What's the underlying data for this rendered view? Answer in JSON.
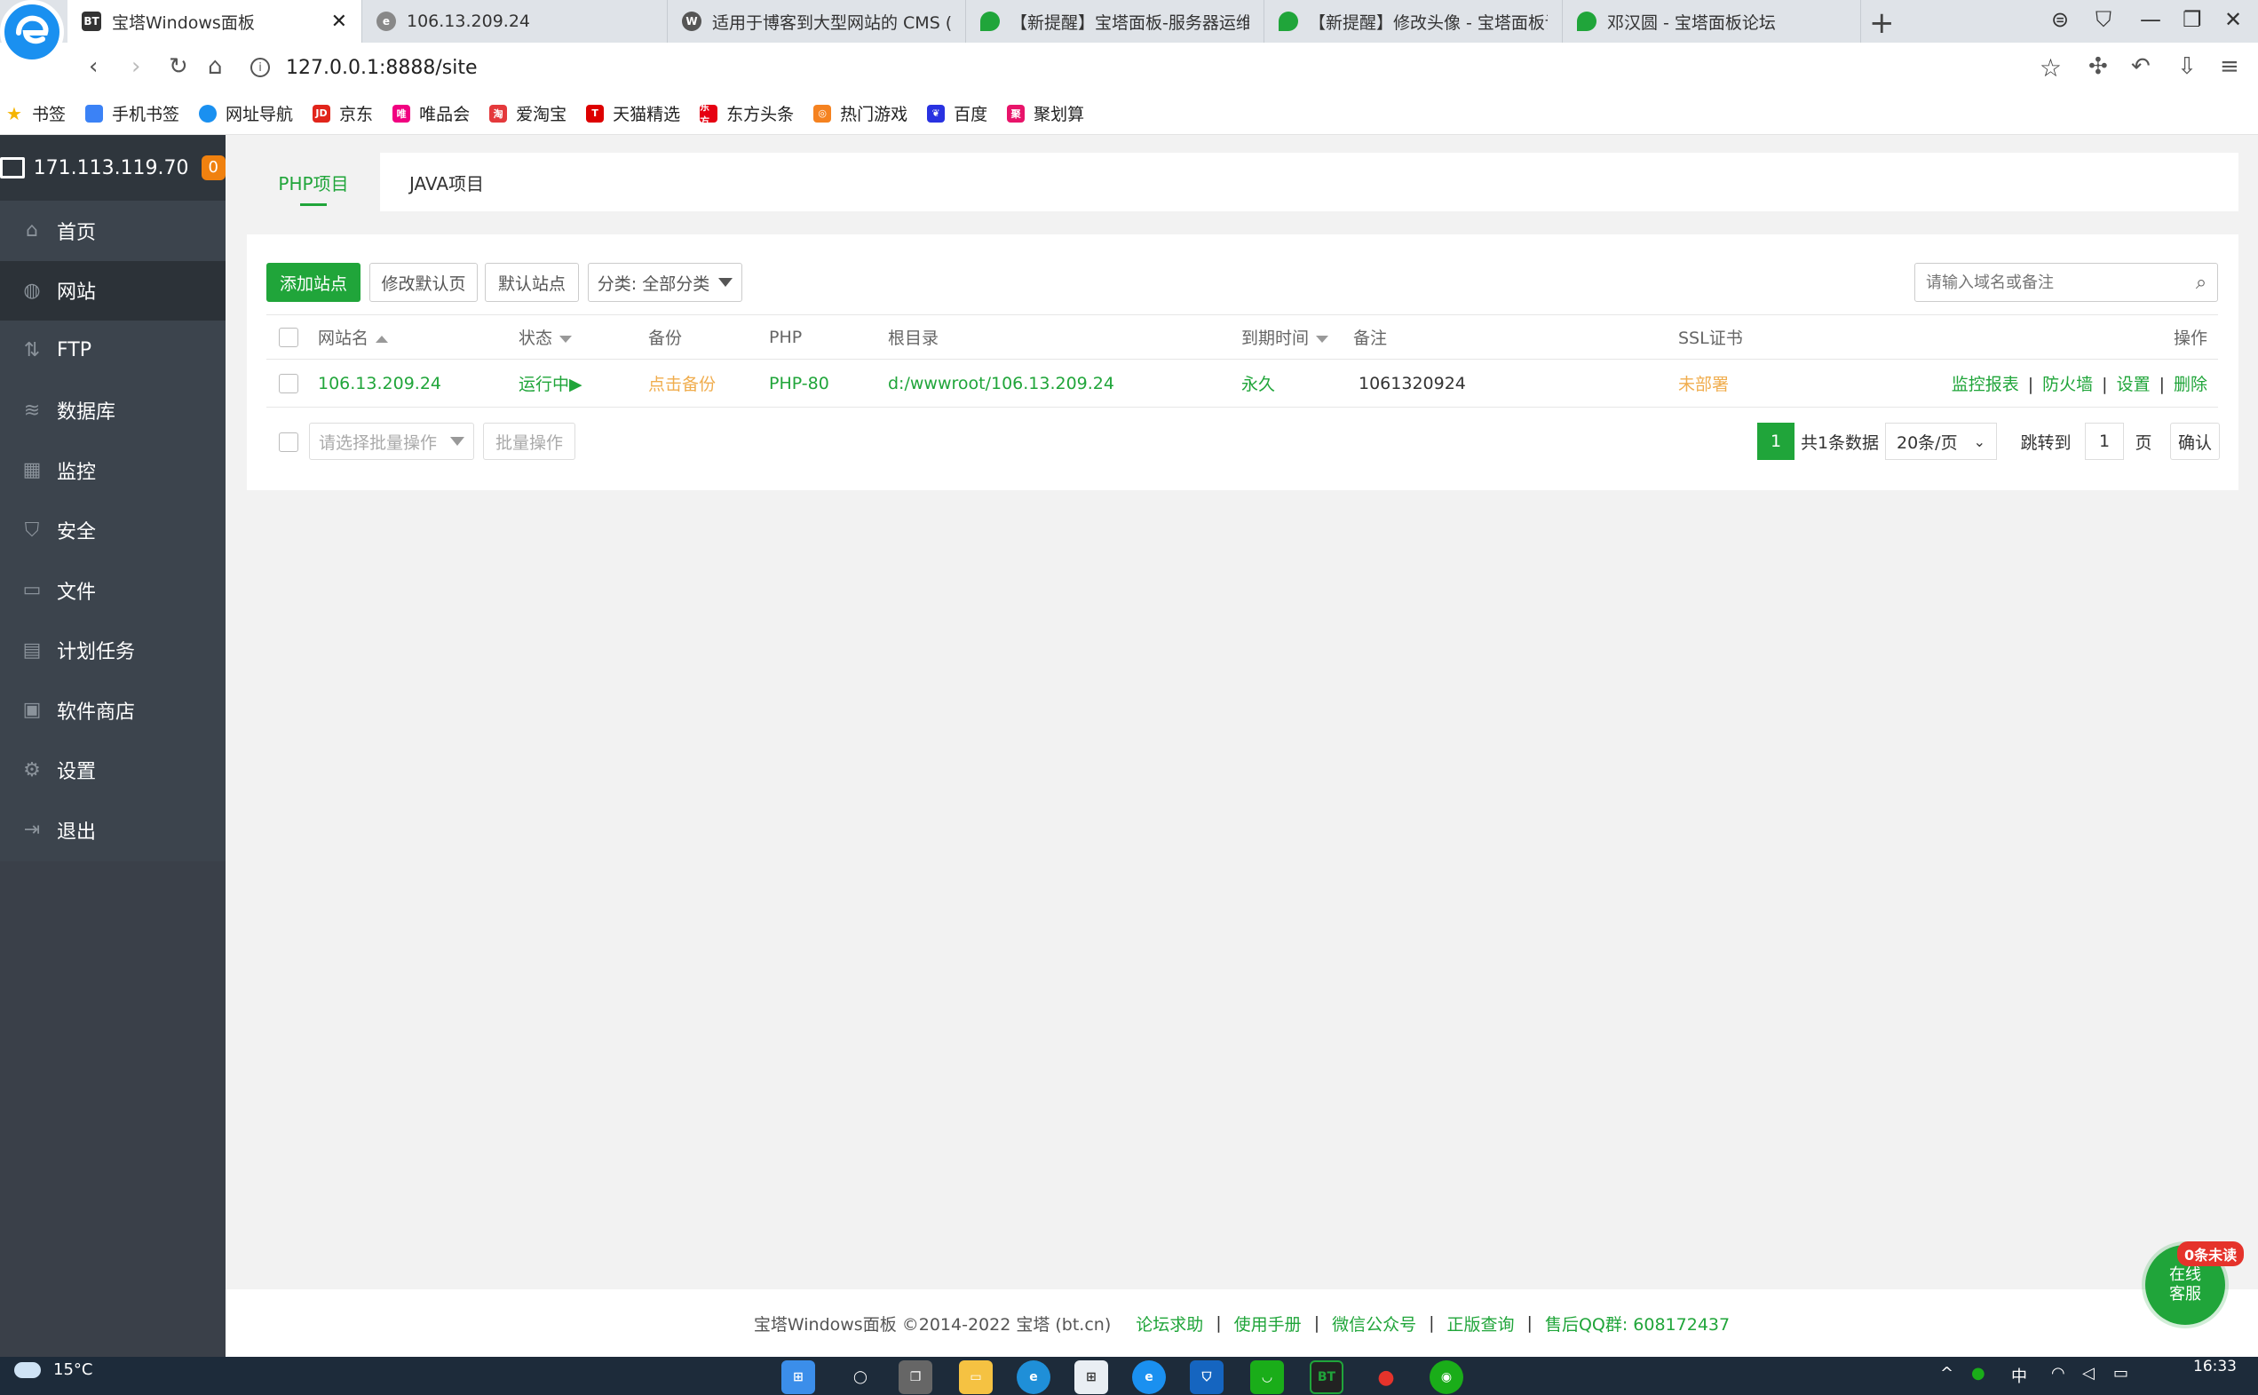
{
  "browser": {
    "tabs": [
      {
        "title": "宝塔Windows面板",
        "favicon": "BT",
        "active": true
      },
      {
        "title": "106.13.209.24",
        "favicon": "ie-icon"
      },
      {
        "title": "适用于博客到大型网站的 CMS (P",
        "favicon": "wordpress-icon"
      },
      {
        "title": "【新提醒】宝塔面板-服务器运维",
        "favicon": "bt-shield-icon"
      },
      {
        "title": "【新提醒】修改头像 - 宝塔面板论",
        "favicon": "bt-shield-icon"
      },
      {
        "title": "邓汉圆 - 宝塔面板论坛",
        "favicon": "bt-shield-icon"
      }
    ],
    "url": "127.0.0.1:8888/site",
    "bookmarks": [
      {
        "label": "书签",
        "color": "#f5b400"
      },
      {
        "label": "手机书签",
        "color": "#3b82f6"
      },
      {
        "label": "网址导航",
        "color": "#1a90f0"
      },
      {
        "label": "京东",
        "color": "#e1251b",
        "mark": "JD"
      },
      {
        "label": "唯品会",
        "color": "#f10180",
        "mark": "唯"
      },
      {
        "label": "爱淘宝",
        "color": "#e4393c",
        "mark": "淘"
      },
      {
        "label": "天猫精选",
        "color": "#d00",
        "mark": "T"
      },
      {
        "label": "东方头条",
        "color": "#e60012",
        "mark": "东方"
      },
      {
        "label": "热门游戏",
        "color": "#f58220",
        "mark": "◎"
      },
      {
        "label": "百度",
        "color": "#2932e1",
        "mark": "❦"
      },
      {
        "label": "聚划算",
        "color": "#e8146a",
        "mark": "聚"
      }
    ]
  },
  "sidebar": {
    "ip": "171.113.119.70",
    "badge": "0",
    "items": [
      {
        "label": "首页",
        "icon": "home-icon",
        "glyph": "⌂"
      },
      {
        "label": "网站",
        "icon": "globe-icon",
        "glyph": "◍",
        "active": true
      },
      {
        "label": "FTP",
        "icon": "ftp-icon",
        "glyph": "⇅"
      },
      {
        "label": "数据库",
        "icon": "database-icon",
        "glyph": "≋"
      },
      {
        "label": "监控",
        "icon": "monitor-icon",
        "glyph": "▦"
      },
      {
        "label": "安全",
        "icon": "shield-icon",
        "glyph": "⛉"
      },
      {
        "label": "文件",
        "icon": "folder-icon",
        "glyph": "▭"
      },
      {
        "label": "计划任务",
        "icon": "calendar-icon",
        "glyph": "▤"
      },
      {
        "label": "软件商店",
        "icon": "apps-icon",
        "glyph": "▣"
      },
      {
        "label": "设置",
        "icon": "gear-icon",
        "glyph": "⚙"
      },
      {
        "label": "退出",
        "icon": "logout-icon",
        "glyph": "⇥"
      }
    ]
  },
  "project_tabs": [
    "PHP项目",
    "JAVA项目"
  ],
  "toolbar": {
    "add_site": "添加站点",
    "edit_default": "修改默认页",
    "default_site": "默认站点",
    "category": "分类: 全部分类",
    "search_placeholder": "请输入域名或备注"
  },
  "table": {
    "headers": {
      "name": "网站名",
      "status": "状态",
      "backup": "备份",
      "php": "PHP",
      "root": "根目录",
      "expire": "到期时间",
      "remark": "备注",
      "ssl": "SSL证书",
      "ops": "操作"
    },
    "rows": [
      {
        "name": "106.13.209.24",
        "status": "运行中▶",
        "backup": "点击备份",
        "php": "PHP-80",
        "root": "d:/wwwroot/106.13.209.24",
        "expire": "永久",
        "remark": "1061320924",
        "ssl": "未部署",
        "ops": [
          "监控报表",
          "防火墙",
          "设置",
          "删除"
        ]
      }
    ]
  },
  "batch": {
    "select_placeholder": "请选择批量操作",
    "button": "批量操作"
  },
  "pagination": {
    "current": "1",
    "total": "共1条数据",
    "per_page": "20条/页",
    "jump_label": "跳转到",
    "jump_value": "1",
    "page_unit": "页",
    "confirm": "确认"
  },
  "footer": {
    "copyright": "宝塔Windows面板 ©2014-2022 宝塔 (bt.cn)",
    "links": [
      "论坛求助",
      "使用手册",
      "微信公众号",
      "正版查询",
      "售后QQ群: 608172437"
    ]
  },
  "online_service": {
    "unread": "0条未读",
    "line1": "在线",
    "line2": "客服"
  },
  "taskbar": {
    "weather": "15°C",
    "ime": "中",
    "time": "16:33"
  },
  "colors": {
    "accent": "#20a53a",
    "warning": "#f0ad4e",
    "sidebar": "#3c444d"
  }
}
